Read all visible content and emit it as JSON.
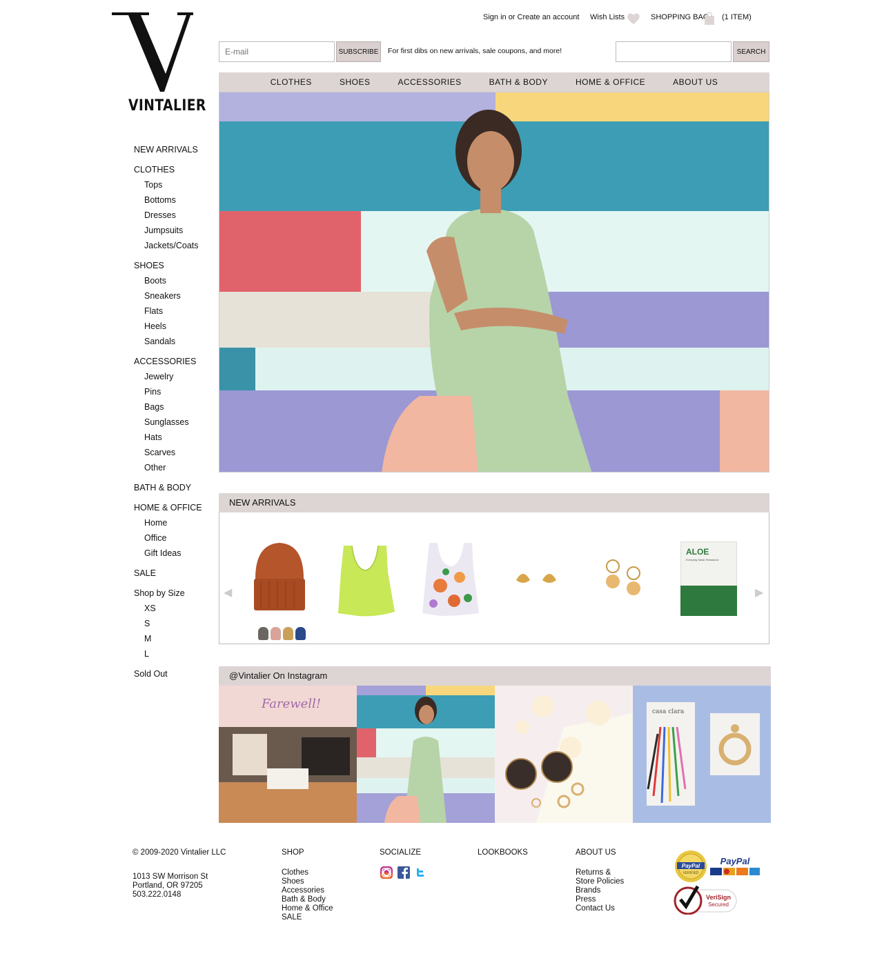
{
  "brand": {
    "name": "VINTALIER"
  },
  "util": {
    "signin": "Sign in or Create an account",
    "wishlists": "Wish Lists",
    "bag": "SHOPPING BAG",
    "bag_count": "(1 ITEM)"
  },
  "subscribe": {
    "placeholder": "E-mail",
    "button": "SUBSCRIBE",
    "promo": "For first dibs on new arrivals, sale coupons, and more!"
  },
  "search": {
    "button": "SEARCH"
  },
  "mainnav": [
    "CLOTHES",
    "SHOES",
    "ACCESSORIES",
    "BATH & BODY",
    "HOME & OFFICE",
    "ABOUT US"
  ],
  "sidebar": {
    "new_arrivals": "NEW ARRIVALS",
    "clothes": {
      "label": "CLOTHES",
      "items": [
        "Tops",
        "Bottoms",
        "Dresses",
        "Jumpsuits",
        "Jackets/Coats"
      ]
    },
    "shoes": {
      "label": "SHOES",
      "items": [
        "Boots",
        "Sneakers",
        "Flats",
        "Heels",
        "Sandals"
      ]
    },
    "accessories": {
      "label": "ACCESSORIES",
      "items": [
        "Jewelry",
        "Pins",
        "Bags",
        "Sunglasses",
        "Hats",
        "Scarves",
        "Other"
      ]
    },
    "bath_body": "BATH & BODY",
    "home_office": {
      "label": "HOME & OFFICE",
      "items": [
        "Home",
        "Office",
        "Gift Ideas"
      ]
    },
    "sale": "SALE",
    "shop_by_size": {
      "label": "Shop by Size",
      "items": [
        "XS",
        "S",
        "M",
        "L"
      ]
    },
    "sold_out": "Sold Out"
  },
  "new_arrivals": {
    "title": "NEW ARRIVALS",
    "prev": "◀",
    "next": "▶",
    "aloe_title": "ALOE",
    "aloe_sub": "Everyday Mask Rebalance",
    "swatch_colors": [
      "#6b6660",
      "#d8a49a",
      "#c9a05a",
      "#2a4a8a"
    ]
  },
  "instagram": {
    "title": "@Vintalier On Instagram",
    "tile1_sign": "Farewell!",
    "tile4_card": "casa clara"
  },
  "footer": {
    "copyright": "© 2009-2020 Vintalier LLC",
    "address1": "1013 SW Morrison St",
    "address2": "Portland, OR 97205",
    "phone": "503.222.0148",
    "shop": {
      "heading": "SHOP",
      "links": [
        "Clothes",
        "Shoes",
        "Accessories",
        "Bath & Body",
        "Home & Office",
        "SALE"
      ]
    },
    "socialize": {
      "heading": "SOCIALIZE"
    },
    "lookbooks": {
      "heading": "LOOKBOOKS"
    },
    "about": {
      "heading": "ABOUT US",
      "links": [
        "Returns &",
        "Store Policies",
        "Brands",
        "Press",
        "Contact Us"
      ]
    },
    "paypal": "PayPal",
    "paypal_verified": "VERIFIED",
    "verisign": "VeriSign",
    "verisign_sub": "Secured"
  }
}
